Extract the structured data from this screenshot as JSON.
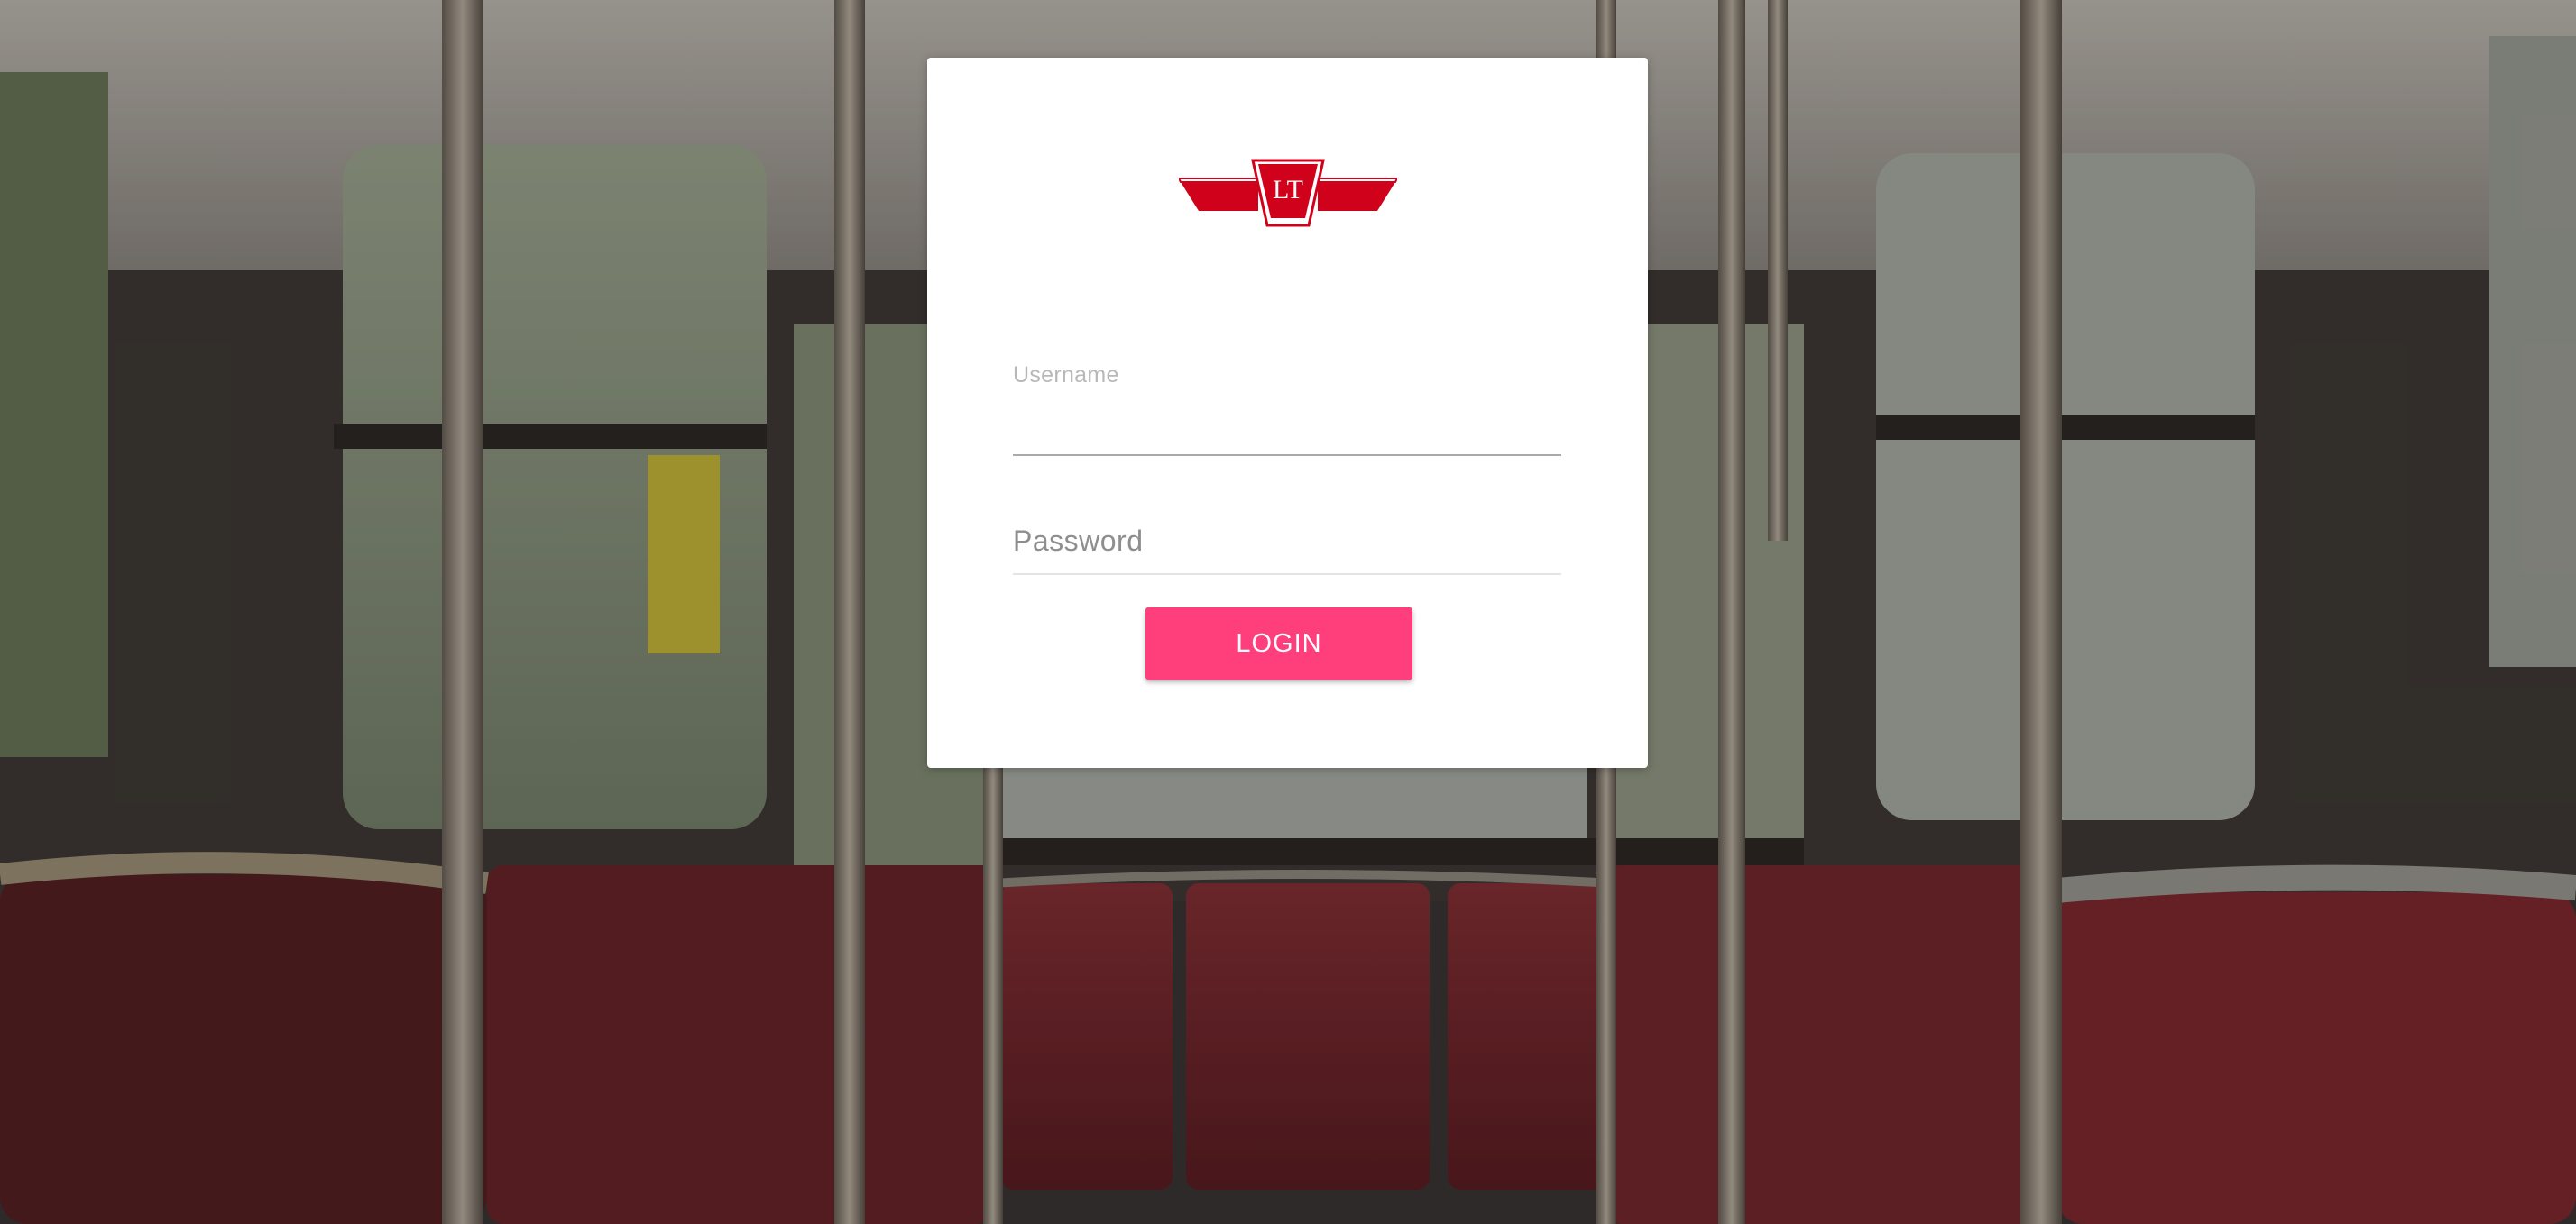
{
  "background": {
    "description": "streetcar-interior-photo"
  },
  "logo": {
    "text": "LT",
    "color": "#d0021b"
  },
  "form": {
    "username": {
      "label": "Username",
      "value": ""
    },
    "password": {
      "placeholder": "Password",
      "value": ""
    },
    "login_label": "LOGIN"
  },
  "colors": {
    "accent": "#ff3f7c",
    "card": "#ffffff",
    "logo_red": "#d0021b"
  }
}
